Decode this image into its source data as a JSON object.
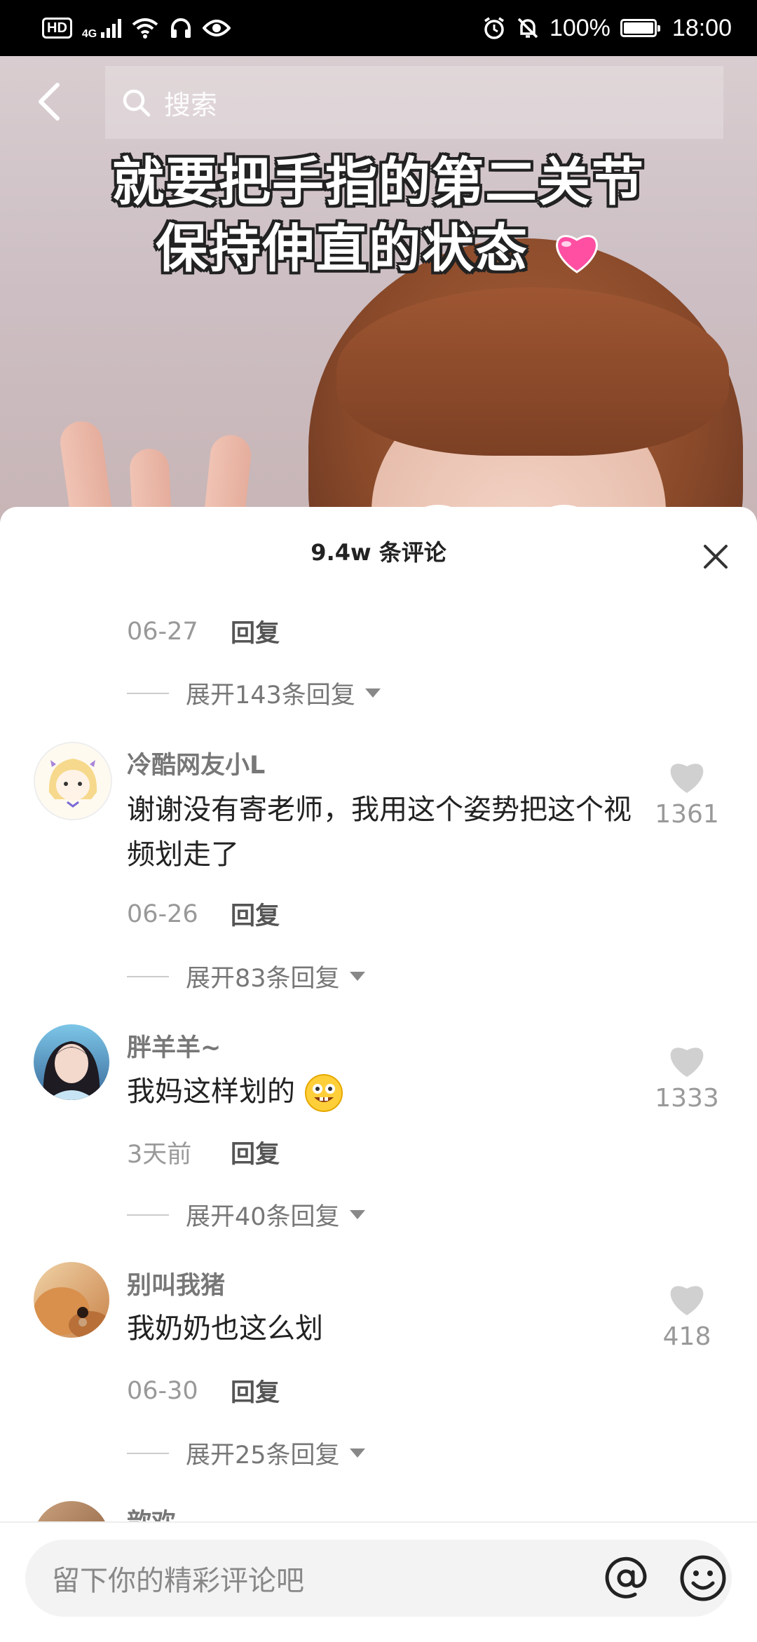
{
  "status_bar": {
    "hd": "HD",
    "network": "4G",
    "battery_pct": "100%",
    "time": "18:00"
  },
  "top": {
    "search_placeholder": "搜索"
  },
  "video": {
    "caption_line1": "就要把手指的第二关节",
    "caption_line2": "保持伸直的状态"
  },
  "comments_sheet": {
    "title": "9.4w 条评论",
    "top_partial": {
      "date": "06-27",
      "reply": "回复",
      "expand": "展开143条回复"
    },
    "comments": [
      {
        "user": "冷酷网友小L",
        "text": "谢谢没有寄老师，我用这个姿势把这个视频划走了",
        "likes": "1361",
        "date": "06-26",
        "reply": "回复",
        "expand": "展开83条回复"
      },
      {
        "user": "胖羊羊~",
        "text": "我妈这样划的",
        "likes": "1333",
        "date": "3天前",
        "reply": "回复",
        "expand": "展开40条回复"
      },
      {
        "user": "别叫我猪",
        "text": "我奶奶也这么划",
        "likes": "418",
        "date": "06-30",
        "reply": "回复",
        "expand": "展开25条回复"
      },
      {
        "user": "歆欢"
      }
    ]
  },
  "bottom_bar": {
    "input_placeholder": "留下你的精彩评论吧"
  },
  "icons": {
    "back": "chevron-left-icon",
    "search": "search-icon",
    "close": "close-icon",
    "like": "heart-icon",
    "mention": "at-icon",
    "emoji": "smiley-icon"
  }
}
